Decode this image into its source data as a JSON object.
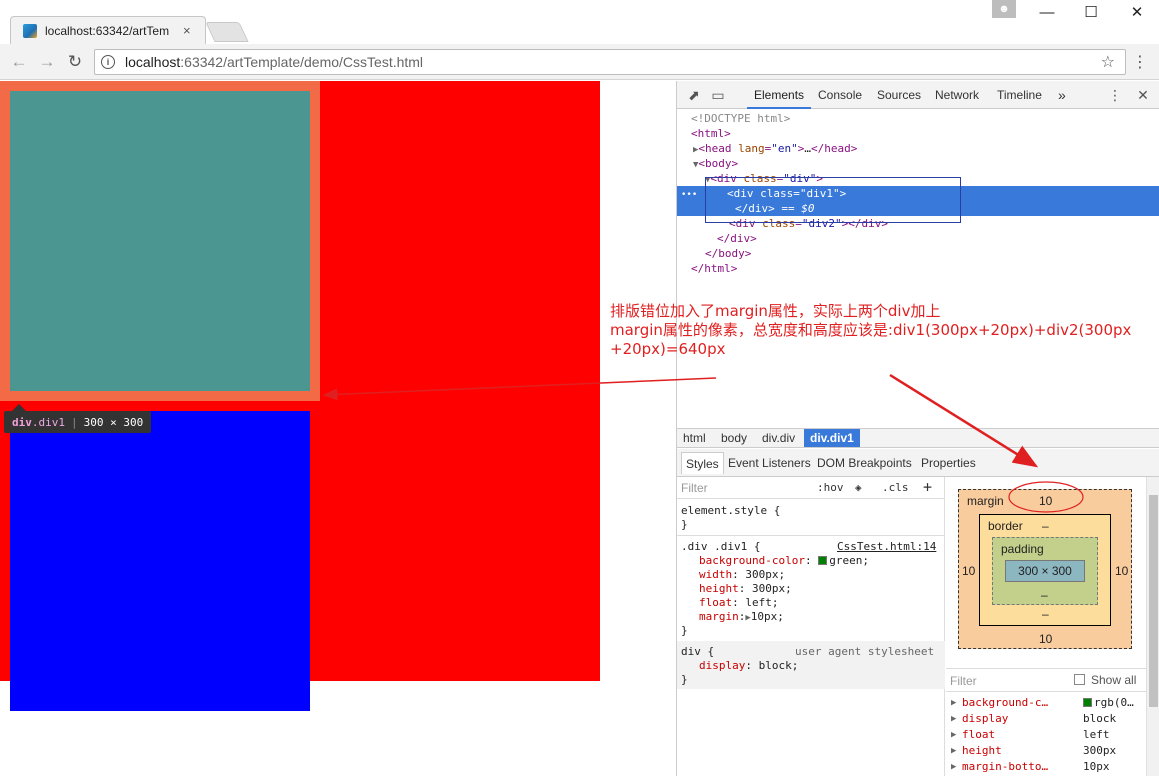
{
  "browser": {
    "tab_title": "localhost:63342/artTem",
    "tab_close": "×",
    "url_host": "localhost",
    "url_rest": ":63342/artTemplate/demo/CssTest.html",
    "window_min": "—",
    "window_max": "☐",
    "window_close": "✕"
  },
  "page": {
    "tooltip_tag": "div",
    "tooltip_class": ".div1",
    "tooltip_size": "300 × 300"
  },
  "devtools": {
    "tabs": [
      "Elements",
      "Console",
      "Sources",
      "Network",
      "Timeline"
    ],
    "more": "»",
    "dom": {
      "doctype": "<!DOCTYPE html>",
      "html_open": "<html>",
      "head": "head",
      "head_attr": "lang",
      "head_val": "\"en\"",
      "body": "body",
      "div": "div",
      "class_attr": "class",
      "div_val": "\"div\"",
      "div1_val": "\"div1\"",
      "div2_val": "\"div2\"",
      "eq0": "== $0",
      "ellipsis": "…",
      "gutter_dots": "•••"
    },
    "breadcrumbs": [
      "html",
      "body",
      "div.div",
      "div.div1"
    ],
    "style_tabs": [
      "Styles",
      "Event Listeners",
      "DOM Breakpoints",
      "Properties"
    ],
    "filter_placeholder": "Filter",
    "hov": ":hov",
    "cls": ".cls",
    "plus": "+",
    "rules": {
      "element_style": "element.style {",
      "close": "}",
      "selector": ".div .div1 {",
      "source": "CssTest.html:14",
      "props": [
        {
          "name": "background-color",
          "value": "green"
        },
        {
          "name": "width",
          "value": "300px"
        },
        {
          "name": "height",
          "value": "300px"
        },
        {
          "name": "float",
          "value": "left"
        },
        {
          "name": "margin",
          "value": "10px"
        }
      ],
      "ua_selector": "div {",
      "ua_source": "user agent stylesheet",
      "ua_prop": {
        "name": "display",
        "value": "block"
      }
    },
    "box_model": {
      "margin_label": "margin",
      "margin_top": "10",
      "margin_bottom": "10",
      "margin_left": "10",
      "margin_right": "10",
      "border_label": "border",
      "border_val": "–",
      "padding_label": "padding",
      "padding_val": "–",
      "content": "300 × 300",
      "dash": "–"
    },
    "computed_filter": "Filter",
    "show_all": "Show all",
    "computed": [
      {
        "name": "background-c…",
        "value": "rgb(0…",
        "swatch": true
      },
      {
        "name": "display",
        "value": "block"
      },
      {
        "name": "float",
        "value": "left"
      },
      {
        "name": "height",
        "value": "300px"
      },
      {
        "name": "margin-botto…",
        "value": "10px"
      }
    ]
  },
  "annotation": {
    "line1": "排版错位加入了margin属性，实际上两个div加上",
    "line2": "margin属性的像素，总宽度和高度应该是:div1(300px+20px)+div2(300px",
    "line3": "+20px)=640px"
  },
  "colors": {
    "red_container": "#ff0000",
    "div1_bg": "#4b9690",
    "div2_bg": "#0000ff",
    "margin_highlight": "#f36b46",
    "annotation": "#e02020",
    "devtools_accent": "#3879d9"
  }
}
